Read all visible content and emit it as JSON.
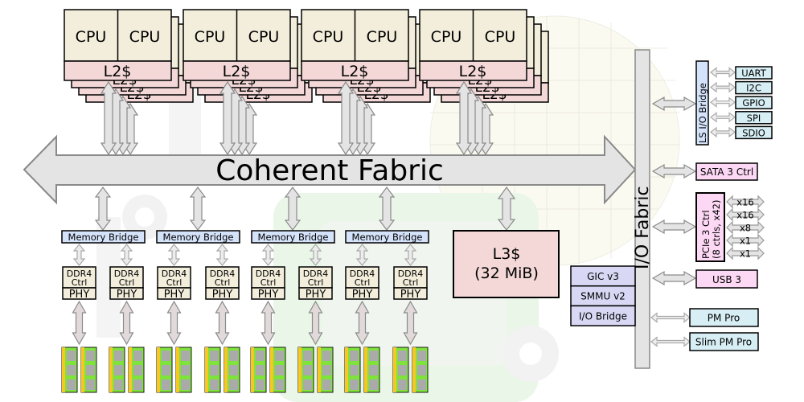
{
  "fabric": {
    "coherent_label": "Coherent Fabric",
    "io_label": "I/O Fabric"
  },
  "cpu_clusters": [
    {
      "cpu_a": "CPU",
      "cpu_b": "CPU",
      "l2": "L2$"
    },
    {
      "cpu_a": "CPU",
      "cpu_b": "CPU",
      "l2": "L2$"
    },
    {
      "cpu_a": "CPU",
      "cpu_b": "CPU",
      "l2": "L2$"
    },
    {
      "cpu_a": "CPU",
      "cpu_b": "CPU",
      "l2": "L2$"
    }
  ],
  "memory_bridges": [
    "Memory Bridge",
    "Memory Bridge",
    "Memory Bridge",
    "Memory Bridge"
  ],
  "ddr_ctrl": {
    "line1": "DDR4",
    "line2": "Ctrl",
    "phy": "PHY",
    "count": 8
  },
  "l3": {
    "line1": "L3$",
    "line2": "(32 MiB)"
  },
  "io_blocks": [
    "GIC v3",
    "SMMU v2",
    "I/O Bridge"
  ],
  "ls_bridge": {
    "label": "LS I/O Bridge",
    "peripherals": [
      "UART",
      "I2C",
      "GPIO",
      "SPI",
      "SDIO"
    ]
  },
  "sata": "SATA 3 Ctrl",
  "pcie": {
    "line1": "PCIe 3 Ctrl",
    "line2": "(8 ctrls, x42)",
    "lanes": [
      "x16",
      "x16",
      "x8",
      "x1",
      "x1"
    ]
  },
  "usb": "USB 3",
  "pm": [
    "PM Pro",
    "Slim PM Pro"
  ],
  "colors": {
    "cpu": "#f3eedb",
    "l2": "#f4d8d8",
    "bridge": "#d5e3fa",
    "io_block": "#d8d8f4",
    "pink": "#fcd8f4",
    "cyan": "#d6eef4",
    "fabric": "#e4e4e4",
    "dimm_green": "#7ee33a",
    "dimm_gold": "#f8c820"
  }
}
